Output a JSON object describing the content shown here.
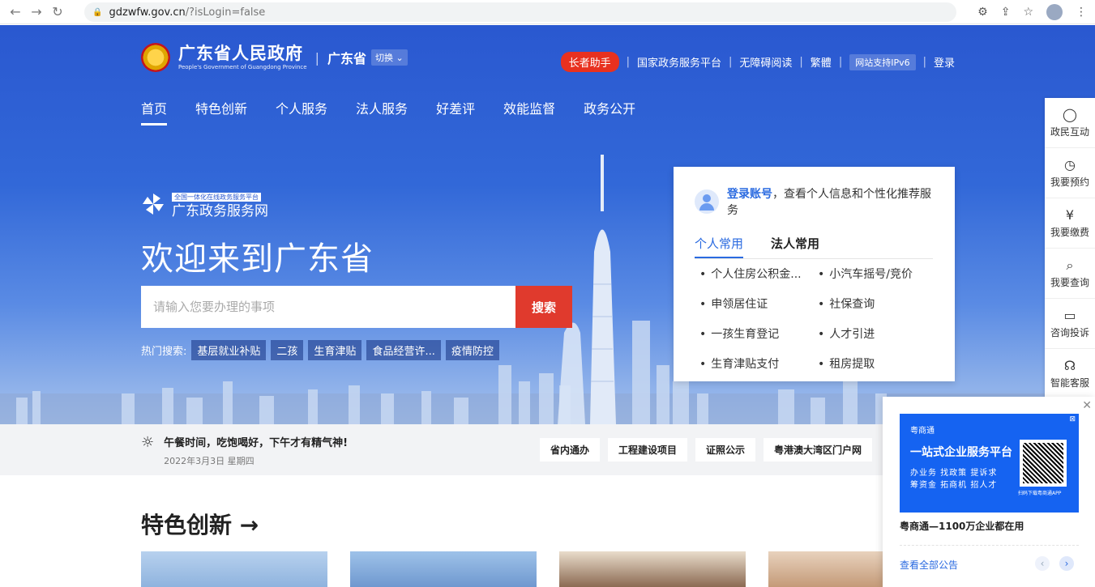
{
  "browser": {
    "url_host": "gdzwfw.gov.cn",
    "url_path": "/?isLogin=false"
  },
  "header": {
    "title": "广东省人民政府",
    "subtitle": "People's Government of Guangdong Province",
    "region": "广东省",
    "switch_label": "切换",
    "links": {
      "elder": "长者助手",
      "national": "国家政务服务平台",
      "accessible": "无障碍阅读",
      "traditional": "繁體",
      "ipv6": "网站支持IPv6",
      "login": "登录"
    }
  },
  "nav": {
    "items": [
      "首页",
      "特色创新",
      "个人服务",
      "法人服务",
      "好差评",
      "效能监督",
      "政务公开"
    ]
  },
  "hero": {
    "portal_tag": "全国一体化在线政务服务平台",
    "portal_name": "广东政务服务网",
    "welcome": "欢迎来到广东省",
    "search_placeholder": "请输入您要办理的事项",
    "search_button": "搜索",
    "hot_label": "热门搜索:",
    "hot_tags": [
      "基层就业补贴",
      "二孩",
      "生育津贴",
      "食品经营许...",
      "疫情防控"
    ]
  },
  "login_card": {
    "login_link": "登录账号",
    "login_text": "，查看个人信息和个性化推荐服务",
    "tabs": [
      "个人常用",
      "法人常用"
    ],
    "items": [
      "个人住房公积金...",
      "小汽车摇号/竞价",
      "申领居住证",
      "社保查询",
      "一孩生育登记",
      "人才引进",
      "生育津贴支付",
      "租房提取"
    ]
  },
  "right_rail": {
    "items": [
      {
        "label": "政民互动",
        "icon": "chat-icon"
      },
      {
        "label": "我要预约",
        "icon": "clock-icon"
      },
      {
        "label": "我要缴费",
        "icon": "payment-icon"
      },
      {
        "label": "我要查询",
        "icon": "search-icon"
      },
      {
        "label": "咨询投诉",
        "icon": "message-icon"
      },
      {
        "label": "智能客服",
        "icon": "headset-icon"
      }
    ]
  },
  "notice": {
    "greeting": "午餐时间，吃饱喝好，下午才有精气神!",
    "date": "2022年3月3日 星期四",
    "quick_links": [
      "省内通办",
      "工程建设项目",
      "证照公示",
      "粤港澳大湾区门户网"
    ]
  },
  "features": {
    "title": "特色创新 →"
  },
  "popup": {
    "ad_brand": "粤商通",
    "ad_title": "一站式企业服务平台",
    "ad_line1": "办业务  找政策  提诉求",
    "ad_line2": "筹资金  拓商机  招人才",
    "ad_foot": "扫码下载粤商通APP",
    "caption": "粤商通—1100万企业都在用",
    "more": "查看全部公告"
  }
}
